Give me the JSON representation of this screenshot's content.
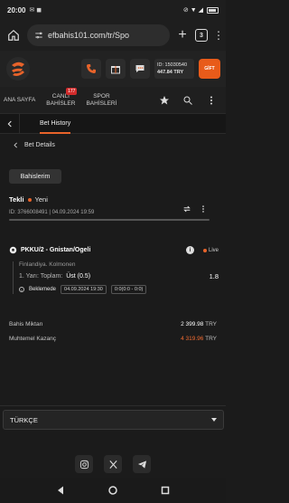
{
  "status_bar": {
    "time": "20:00",
    "left_icons": "✉ ◼",
    "right_icons": "⊘ ▼ ◢"
  },
  "browser": {
    "url": "efbahis101.com/tr/Spo",
    "tab_count": "3"
  },
  "header": {
    "account_id": "ID: 15030540",
    "balance": "447.84 TRY",
    "promo_label": "GİFT"
  },
  "nav": {
    "home": "ANA SAYFA",
    "live_line1": "CANLI",
    "live_line2": "BAHİSLER",
    "live_badge": "177",
    "sport_line1": "SPOR",
    "sport_line2": "BAHİSLERİ"
  },
  "subbar": {
    "title": "Bet History"
  },
  "details": {
    "title": "Bet Details",
    "tab": "Bahislerim"
  },
  "bet": {
    "type": "Tekli",
    "status": "Yeni",
    "id_date": "ID: 3766008491  |  04.09.2024 19:59"
  },
  "event": {
    "name": "PKKU/2 - Gnistan/Ogeli",
    "live": "Live",
    "league": "Finlandiya. Kolmonen",
    "market": "1. Yarı: Toplam:",
    "selection": "Üst (0.5)",
    "odds": "1.8",
    "status": "Beklemede",
    "event_time": "04.09.2024 19:30",
    "score": "0:0(0:0 - 0:0)"
  },
  "totals": {
    "stake_label": "Bahis Miktarı",
    "stake_value": "2 399.98",
    "potential_label": "Muhtemel Kazanç",
    "potential_value": "4 319.96",
    "currency": "TRY"
  },
  "footer": {
    "language": "TÜRKÇE"
  },
  "colors": {
    "accent": "#e8632a",
    "background": "#1b1b1b"
  }
}
